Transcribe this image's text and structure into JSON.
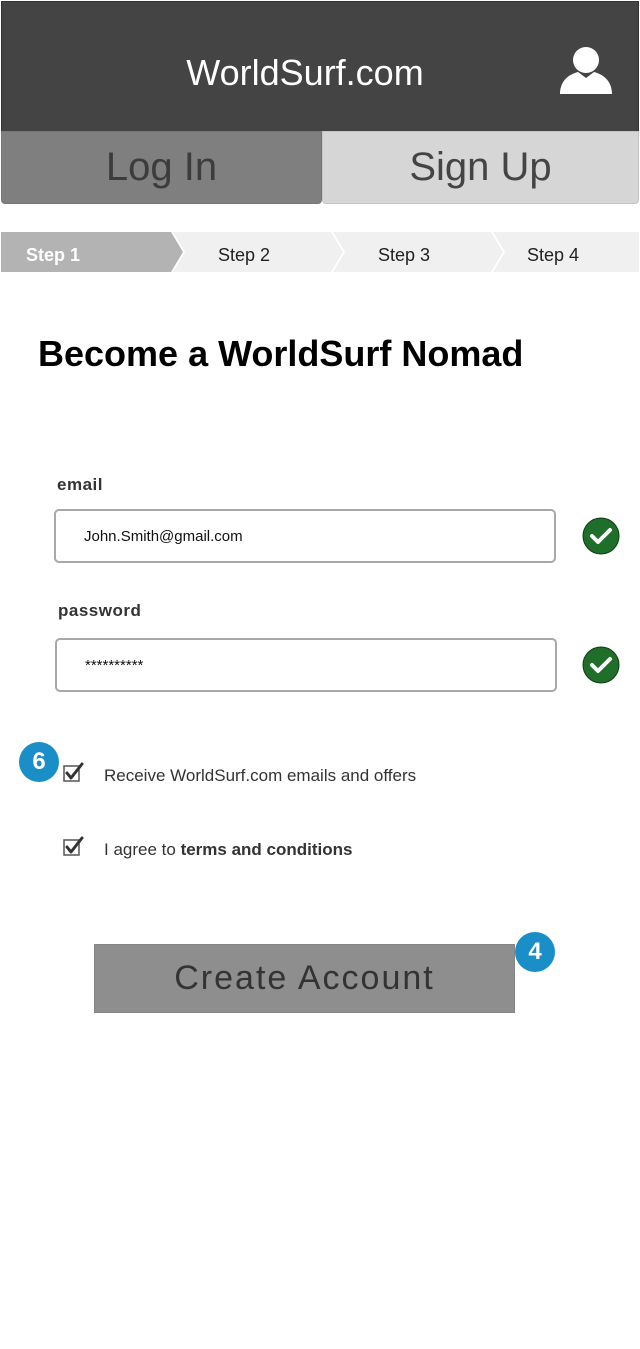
{
  "header": {
    "title": "WorldSurf.com",
    "user_icon": "user-icon"
  },
  "tabs": [
    {
      "label": "Log In",
      "active": false
    },
    {
      "label": "Sign Up",
      "active": true
    }
  ],
  "steps": [
    {
      "label": "Step 1",
      "active": true
    },
    {
      "label": "Step 2",
      "active": false
    },
    {
      "label": "Step 3",
      "active": false
    },
    {
      "label": "Step 4",
      "active": false
    }
  ],
  "heading": "Become a WorldSurf Nomad",
  "form": {
    "email": {
      "label": "email",
      "value": "John.Smith@gmail.com",
      "valid": true
    },
    "password": {
      "label": "password",
      "value": "**********",
      "valid": true
    }
  },
  "checkboxes": [
    {
      "text": "Receive WorldSurf.com emails and offers",
      "checked": true
    },
    {
      "text_prefix": "I agree to ",
      "text_link": "terms and conditions",
      "checked": true
    }
  ],
  "annotations": {
    "badge_checkbox": "6",
    "badge_button": "4"
  },
  "create_button": {
    "label": "Create Account"
  },
  "colors": {
    "header_bg": "#444444",
    "valid_green": "#1f6e2a",
    "badge_blue": "#1a8ec7"
  }
}
